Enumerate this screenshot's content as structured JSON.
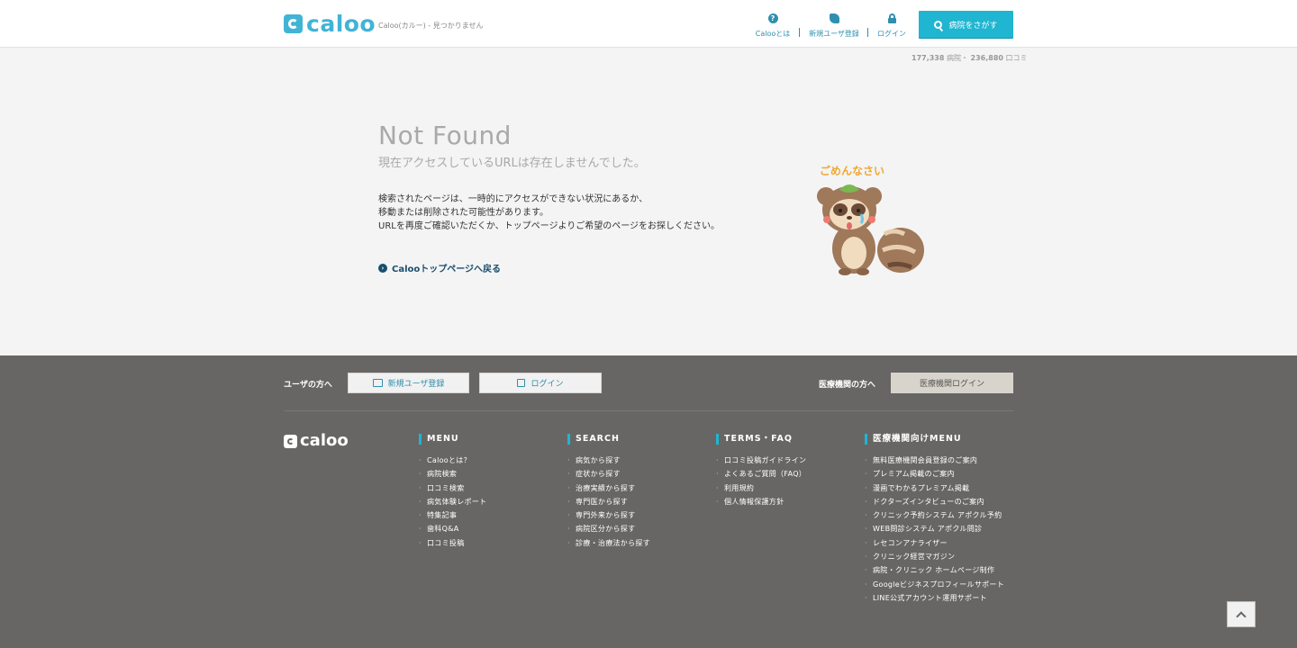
{
  "header": {
    "logo_text": "caloo",
    "tagline": "Caloo(カルー) - 見つかりません",
    "nav": [
      {
        "label": "Calooとは",
        "icon": "question-icon"
      },
      {
        "label": "新規ユーザ登録",
        "icon": "beginner-leaf-icon"
      },
      {
        "label": "ログイン",
        "icon": "lock-icon"
      }
    ],
    "search_label": "病院をさがす",
    "stats": {
      "hospitals_count": "177,338",
      "hospitals_label": "病院・",
      "reviews_count": "236,880",
      "reviews_label": "口コミ"
    }
  },
  "main": {
    "title": "Not Found",
    "subtitle": "現在アクセスしているURLは存在しませんでした。",
    "body": [
      "検索されたページは、一時的にアクセスができない状況にあるか、",
      "移動または削除された可能性があります。",
      "URLを再度ご確認いただくか、トップページよりご希望のページをお探しください。"
    ],
    "back_link": "Calooトップページへ戻る",
    "mascot_text": "ごめんなさい"
  },
  "footer": {
    "user_label": "ユーザの方へ",
    "register_label": "新規ユーザ登録",
    "login_label": "ログイン",
    "medical_label": "医療機関の方へ",
    "medical_login_label": "医療機関ログイン",
    "logo_text": "caloo",
    "columns": [
      {
        "title": "MENU",
        "items": [
          "Calooとは？",
          "病院検索",
          "口コミ検索",
          "病気体験レポート",
          "特集記事",
          "歯科Q&A",
          "口コミ投稿"
        ]
      },
      {
        "title": "SEARCH",
        "items": [
          "病気から探す",
          "症状から探す",
          "治療実績から探す",
          "専門医から探す",
          "専門外来から探す",
          "病院区分から探す",
          "診療・治療法から探す"
        ]
      },
      {
        "title": "TERMS・FAQ",
        "items": [
          "口コミ投稿ガイドライン",
          "よくあるご質問（FAQ）",
          "利用規約",
          "個人情報保護方針"
        ]
      },
      {
        "title": "医療機関向けMENU",
        "items": [
          "無料医療機関会員登録のご案内",
          "プレミアム掲載のご案内",
          "漫画でわかるプレミアム掲載",
          "ドクターズインタビューのご案内",
          "クリニック予約システム アポクル予約",
          "WEB問診システム アポクル問診",
          "レセコンアナライザー",
          "クリニック経営マガジン",
          "病院・クリニック ホームページ制作",
          "Googleビジネスプロフィールサポート",
          "LINE公式アカウント運用サポート"
        ]
      }
    ]
  },
  "colors": {
    "accent": "#20b5d1",
    "logo": "#41b4d6",
    "footer_bg": "#686664"
  }
}
